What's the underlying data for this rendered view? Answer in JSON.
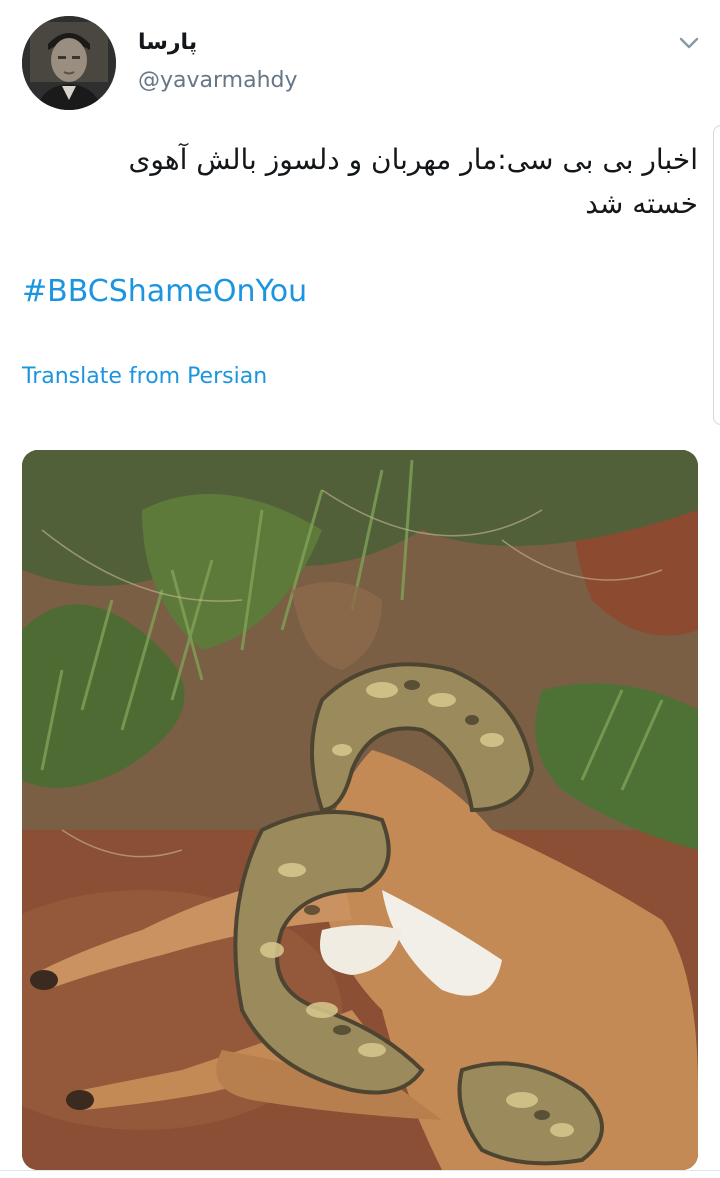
{
  "tweet": {
    "display_name": "پارسا",
    "handle": "@yavarmahdy",
    "text": "اخبار  بی بی سی:مار مهربان و دلسوز بالش آهوی خسته شد",
    "hashtag": "#BBCShameOnYou",
    "translate_label": "Translate from Persian"
  },
  "icons": {
    "menu": "chevron-down-icon"
  },
  "colors": {
    "link": "#1b95e0",
    "handle": "#657786",
    "text": "#14171a"
  }
}
